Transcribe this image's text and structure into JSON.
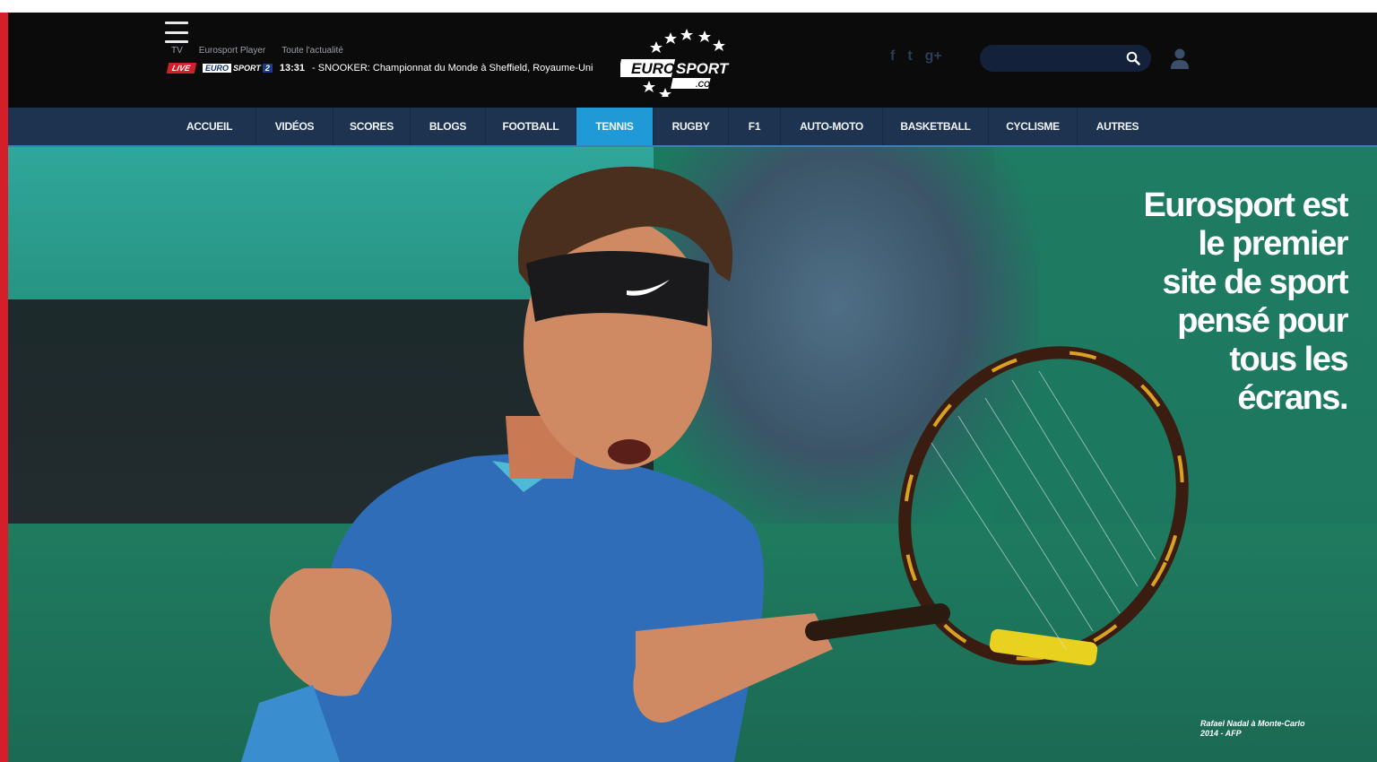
{
  "header": {
    "menu_icon": "hamburger-icon",
    "links": [
      "TV",
      "Eurosport Player",
      "Toute l'actualité"
    ],
    "ticker": {
      "live_label": "LIVE",
      "channel_badge": {
        "brand": "EURO",
        "name": "SPORT",
        "number": "2"
      },
      "time": "13:31",
      "text": "- SNOOKER: Championnat du Monde à Sheffield, Royaume-Uni"
    },
    "logo": {
      "line1": "EURO",
      "line2": "SPORT",
      "domain": ".COM"
    },
    "social_icons": [
      "facebook-icon",
      "twitter-icon",
      "google-plus-icon"
    ],
    "social_glyphs": [
      "f",
      "t",
      "g+"
    ],
    "search": {
      "placeholder": "",
      "icon": "search-icon"
    },
    "user_icon": "user-icon"
  },
  "nav": {
    "items": [
      {
        "label": "ACCUEIL",
        "active": false
      },
      {
        "label": "VIDÉOS",
        "active": false
      },
      {
        "label": "SCORES",
        "active": false
      },
      {
        "label": "BLOGS",
        "active": false
      },
      {
        "label": "FOOTBALL",
        "active": false
      },
      {
        "label": "TENNIS",
        "active": true
      },
      {
        "label": "RUGBY",
        "active": false
      },
      {
        "label": "F1",
        "active": false
      },
      {
        "label": "AUTO-MOTO",
        "active": false
      },
      {
        "label": "BASKETBALL",
        "active": false
      },
      {
        "label": "CYCLISME",
        "active": false
      },
      {
        "label": "AUTRES",
        "active": false
      }
    ]
  },
  "hero": {
    "headline_lines": [
      "Eurosport est",
      "le premier",
      "site de sport",
      "pensé pour",
      "tous les",
      "écrans."
    ],
    "caption_lines": [
      "Rafael Nadal à Monte-Carlo",
      "2014 - AFP"
    ]
  },
  "colors": {
    "header_bg": "#0b0b0c",
    "nav_bg": "#1d3350",
    "nav_active": "#1f9ad6",
    "live_red": "#d41f2a",
    "court_green": "#1b7a5e"
  }
}
